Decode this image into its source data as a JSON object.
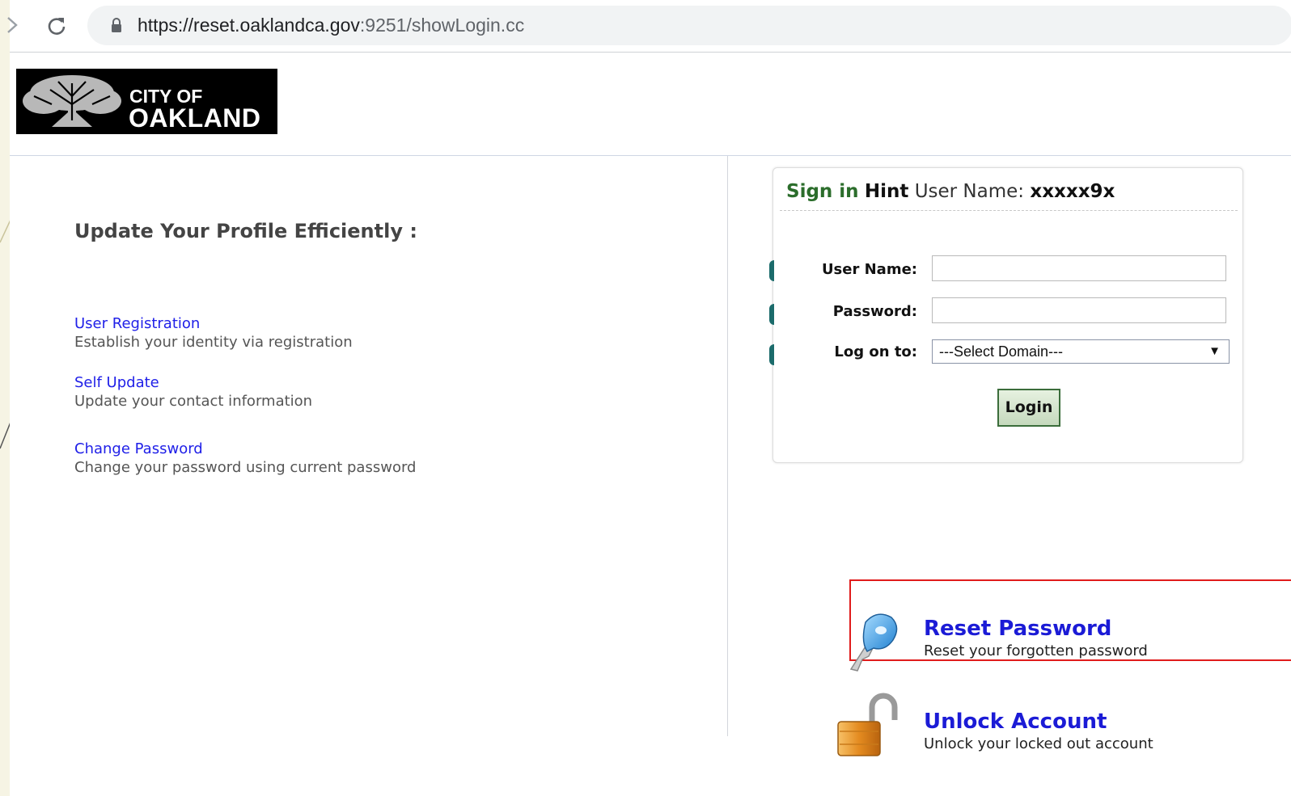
{
  "browser": {
    "url_host": "https://reset.oaklandca.gov",
    "url_rest": ":9251/showLogin.cc"
  },
  "logo": {
    "line1": "CITY OF",
    "line2": "OAKLAND"
  },
  "left": {
    "heading": "Update Your Profile Efficiently :",
    "features": [
      {
        "link": "User Registration",
        "desc": "Establish your identity via registration"
      },
      {
        "link": "Self Update",
        "desc": "Update your contact information"
      },
      {
        "link": "Change Password",
        "desc": "Change your password using current password"
      }
    ]
  },
  "login": {
    "hint_sign": "Sign in",
    "hint_word": "Hint",
    "hint_label": " User Name: ",
    "hint_value": "xxxxx9x",
    "username_label": "User Name:",
    "username_value": "",
    "password_label": "Password:",
    "password_value": "",
    "logon_label": "Log on to:",
    "domain_selected": "---Select Domain---",
    "login_button": "Login"
  },
  "actions": [
    {
      "title": "Reset Password",
      "desc": "Reset your forgotten password",
      "icon": "key-icon"
    },
    {
      "title": "Unlock Account",
      "desc": "Unlock your locked out account",
      "icon": "padlock-icon"
    }
  ],
  "colors": {
    "link": "#2020e8",
    "action_title": "#1b1bd6",
    "highlight": "#e01b1b",
    "hint_green": "#2b6d2b",
    "button_border": "#3b6d3b"
  }
}
